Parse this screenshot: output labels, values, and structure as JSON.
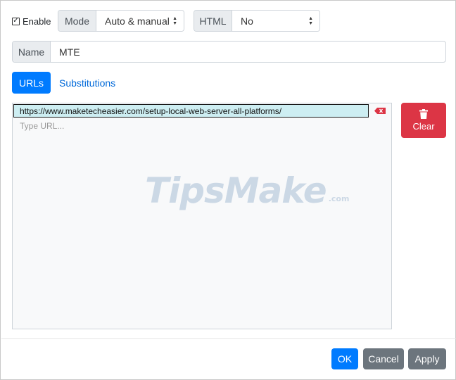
{
  "top": {
    "enable_label": "Enable",
    "enable_checked": true,
    "mode_label": "Mode",
    "mode_value": "Auto & manual",
    "html_label": "HTML",
    "html_value": "No"
  },
  "name": {
    "label": "Name",
    "value": "MTE"
  },
  "tabs": [
    {
      "label": "URLs",
      "active": true
    },
    {
      "label": "Substitutions",
      "active": false
    }
  ],
  "urls": {
    "items": [
      "https://www.maketecheasier.com/setup-local-web-server-all-platforms/"
    ],
    "placeholder": "Type URL..."
  },
  "clear_label": "Clear",
  "watermark": {
    "main": "TipsMake",
    "suffix": ".com"
  },
  "footer": {
    "ok_label": "OK",
    "cancel_label": "Cancel",
    "apply_label": "Apply"
  },
  "colors": {
    "primary": "#007bff",
    "danger": "#dc3545",
    "secondary": "#6c757d",
    "selected_row": "#cdeef2"
  },
  "icons": {
    "delete_row": "x-tag-icon",
    "clear": "trash-icon",
    "select_arrows": "up-down-icon"
  }
}
